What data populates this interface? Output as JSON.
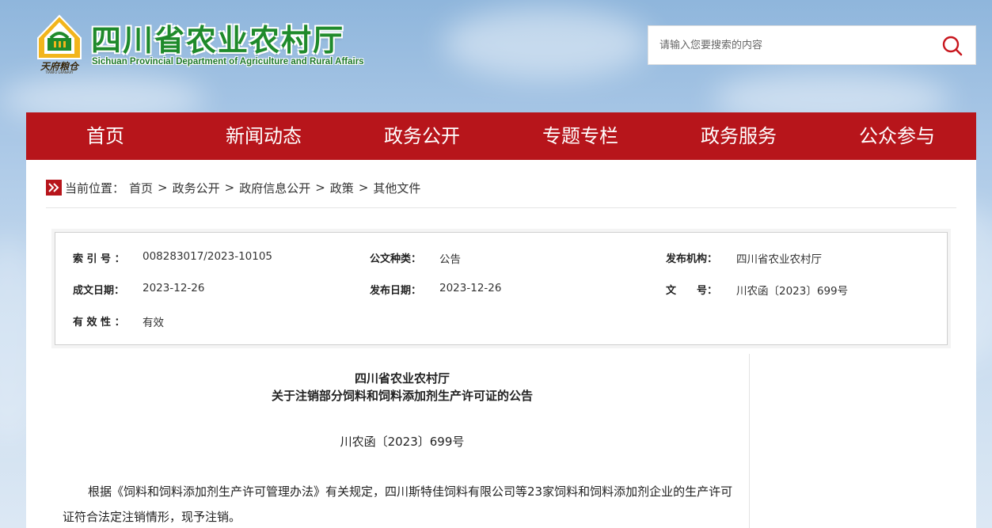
{
  "header": {
    "logo_emblem_text": "天府粮仓",
    "logo_emblem_subtext": "TIANFU GRANARY",
    "title": "四川省农业农村厅",
    "subtitle": "Sichuan Provincial Department of Agriculture and Rural Affairs",
    "search_placeholder": "请输入您要搜索的内容",
    "brand_color": "#1f8a2b"
  },
  "nav": {
    "color": "#b7151b",
    "items": [
      {
        "label": "首页"
      },
      {
        "label": "新闻动态"
      },
      {
        "label": "政务公开"
      },
      {
        "label": "专题专栏"
      },
      {
        "label": "政务服务"
      },
      {
        "label": "公众参与"
      }
    ]
  },
  "breadcrumb": {
    "prefix": "当前位置：",
    "items": [
      "首页",
      "政务公开",
      "政府信息公开",
      "政策",
      "其他文件"
    ],
    "separator": ">"
  },
  "info": {
    "index_label": "索 引 号 ：",
    "index_value": "008283017/2023-10105",
    "type_label": "公文种类：",
    "type_value": "公告",
    "issuer_label": "发布机构：",
    "issuer_value": "四川省农业农村厅",
    "created_label": "成文日期：",
    "created_value": "2023-12-26",
    "published_label": "发布日期：",
    "published_value": "2023-12-26",
    "docno_label": "文　　号：",
    "docno_value": "川农函〔2023〕699号",
    "validity_label": "有 效 性 ：",
    "validity_value": "有效"
  },
  "article": {
    "title_line1": "四川省农业农村厅",
    "title_line2": "关于注销部分饲料和饲料添加剂生产许可证的公告",
    "doc_number": "川农函〔2023〕699号",
    "paragraph": "根据《饲料和饲料添加剂生产许可管理办法》有关规定，四川斯特佳饲料有限公司等23家饲料和饲料添加剂企业的生产许可证符合法定注销情形，现予注销。"
  }
}
